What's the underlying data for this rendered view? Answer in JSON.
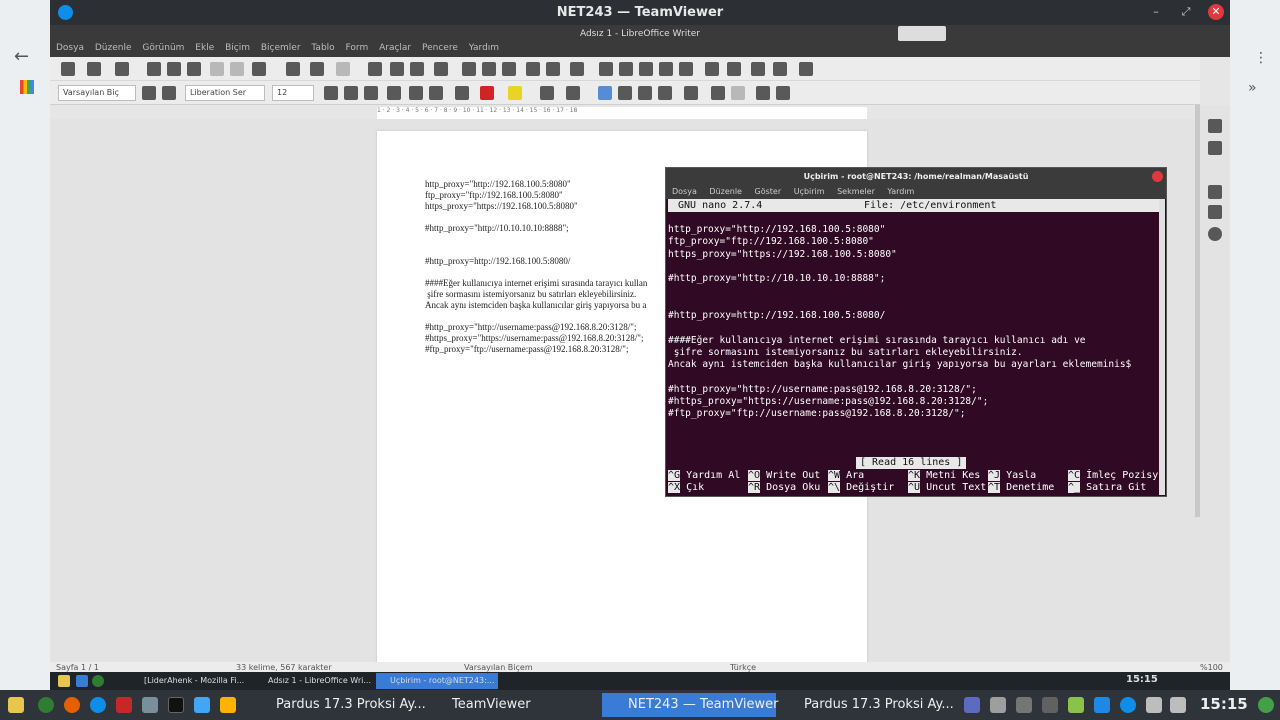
{
  "teamviewer": {
    "title": "NET243 — TeamViewer"
  },
  "libreoffice": {
    "title": "Adsız 1 - LibreOffice Writer",
    "menu": [
      "Dosya",
      "Düzenle",
      "Görünüm",
      "Ekle",
      "Biçim",
      "Biçemler",
      "Tablo",
      "Form",
      "Araçlar",
      "Pencere",
      "Yardım"
    ],
    "paragraph_style": "Varsayılan Biç",
    "font_name": "Liberation Ser",
    "font_size": "12",
    "ruler": "1 · 2 · 3 · 4 · 5 · 6 · 7 · 8 · 9 · 10 · 11 · 12 · 13 · 14 · 15 · 16 · 17 · 18",
    "doc_text": "http_proxy=\"http://192.168.100.5:8080\"\nftp_proxy=\"ftp://192.168.100.5:8080\"\nhttps_proxy=\"https://192.168.100.5:8080\"\n\n#http_proxy=\"http://10.10.10.10:8888\";\n\n\n#http_proxy=http://192.168.100.5:8080/\n\n####Eğer kullanıcıya internet erişimi sırasında tarayıcı kullan\n şifre sormasını istemiyorsanız bu satırları ekleyebilirsiniz.\nAncak aynı istemciden başka kullanıcılar giriş yapıyorsa bu a\n\n#http_proxy=\"http://username:pass@192.168.8.20:3128/\";\n#https_proxy=\"https://username:pass@192.168.8.20:3128/\";\n#ftp_proxy=\"ftp://username:pass@192.168.8.20:3128/\";",
    "status": {
      "page": "Sayfa 1 / 1",
      "words": "33 kelime, 567 karakter",
      "style": "Varsayılan Biçem",
      "lang": "Türkçe",
      "zoom": "%100"
    }
  },
  "terminal": {
    "title": "Uçbirim - root@NET243: /home/realman/Masaüstü",
    "menu": [
      "Dosya",
      "Düzenle",
      "Göster",
      "Uçbirim",
      "Sekmeler",
      "Yardım"
    ],
    "nano_version": "GNU nano 2.7.4",
    "file_label": "File: /etc/environment",
    "content": "http_proxy=\"http://192.168.100.5:8080\"\nftp_proxy=\"ftp://192.168.100.5:8080\"\nhttps_proxy=\"https://192.168.100.5:8080\"\n\n#http_proxy=\"http://10.10.10.10:8888\";\n\n\n#http_proxy=http://192.168.100.5:8080/\n\n####Eğer kullanıcıya internet erişimi sırasında tarayıcı kullanıcı adı ve\n şifre sormasını istemiyorsanız bu satırları ekleyebilirsiniz.\nAncak aynı istemciden başka kullanıcılar giriş yapıyorsa bu ayarları eklememinis$\n\n#http_proxy=\"http://username:pass@192.168.8.20:3128/\";\n#https_proxy=\"https://username:pass@192.168.8.20:3128/\";\n#ftp_proxy=\"ftp://username:pass@192.168.8.20:3128/\";",
    "status_msg": "[ Read 16 lines ]",
    "shortcuts_row1": [
      [
        "^G",
        "Yardım Al"
      ],
      [
        "^O",
        "Write Out"
      ],
      [
        "^W",
        "Ara"
      ],
      [
        "^K",
        "Metni Kes"
      ],
      [
        "^J",
        "Yasla"
      ],
      [
        "^C",
        "İmleç Pozisy"
      ]
    ],
    "shortcuts_row2": [
      [
        "^X",
        "Çık"
      ],
      [
        "^R",
        "Dosya Oku"
      ],
      [
        "^\\",
        "Değiştir"
      ],
      [
        "^U",
        "Uncut Text"
      ],
      [
        "^T",
        "Denetime"
      ],
      [
        "^_",
        "Satıra Git"
      ]
    ]
  },
  "session_taskbar": {
    "items": [
      "[LiderAhenk - Mozilla Fi...",
      "Adsız 1 - LibreOffice Wri...",
      "Uçbirim - root@NET243:..."
    ],
    "clock": "15:15"
  },
  "host_taskbar": {
    "items": [
      "Pardus 17.3 Proksi Ay...",
      "TeamViewer",
      "NET243 — TeamViewer",
      "Pardus 17.3 Proksi Ay..."
    ],
    "clock": "15:15"
  }
}
